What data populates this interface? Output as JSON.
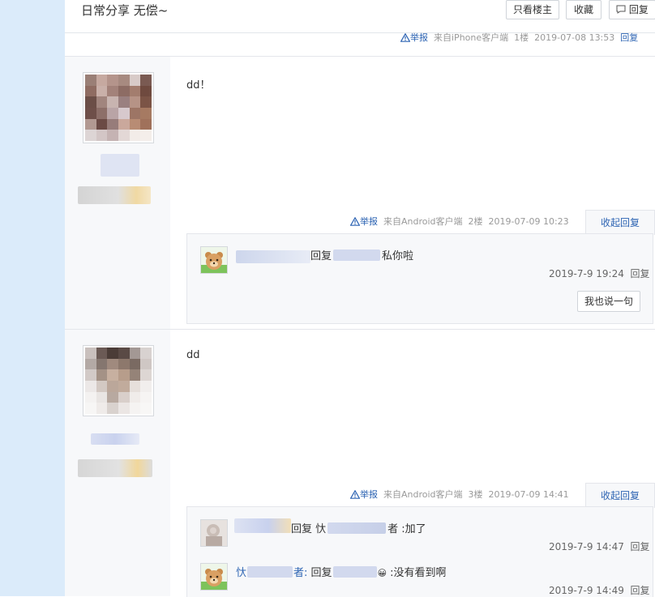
{
  "header": {
    "title": "日常分享 无偿~",
    "btn_only_lz": "只看楼主",
    "btn_collect": "收藏",
    "btn_reply": "回复"
  },
  "floor1_meta": {
    "report": "举报",
    "source": "来自iPhone客户端",
    "floor": "1楼",
    "time": "2019-07-08 13:53",
    "reply": "回复"
  },
  "post2": {
    "text": "dd！",
    "meta": {
      "report": "举报",
      "source": "来自Android客户端",
      "floor": "2楼",
      "time": "2019-07-09 10:23"
    },
    "collapse": "收起回复",
    "comments": [
      {
        "pre": "回复",
        "text": "私你啦",
        "time": "2019-7-9 19:24",
        "reply": "回复"
      }
    ],
    "say_btn": "我也说一句"
  },
  "post3": {
    "text": "dd",
    "meta": {
      "report": "举报",
      "source": "来自Android客户端",
      "floor": "3楼",
      "time": "2019-07-09 14:41"
    },
    "collapse": "收起回复",
    "comments": [
      {
        "pre": "回复 忕",
        "text": "者 :加了",
        "time": "2019-7-9 14:47",
        "reply": "回复"
      },
      {
        "user": "忕",
        "user2": "者:",
        "pre": "回复",
        "emoji": "😀",
        "text": " :没有看到啊",
        "time": "2019-7-9 14:49",
        "reply": "回复"
      }
    ]
  },
  "colors": {
    "sidebar_bg": "#dbebfa",
    "link": "#2d64b3",
    "user_pad": "#f7f8fa"
  },
  "icons": [
    "warning-icon",
    "comment-icon",
    "bear-avatar-icon"
  ]
}
